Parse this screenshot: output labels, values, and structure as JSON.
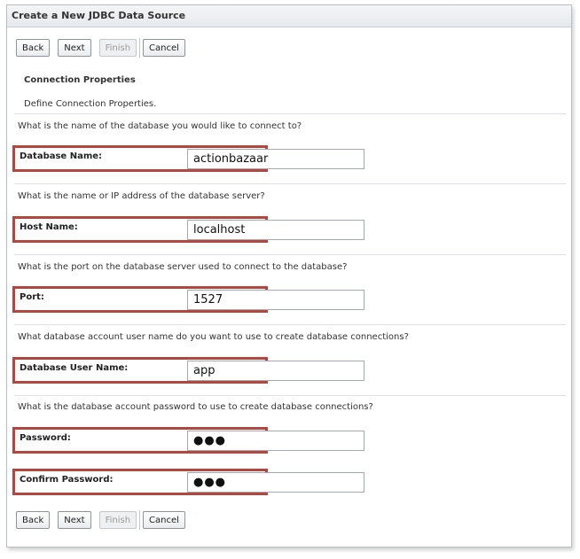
{
  "window": {
    "title": "Create a New JDBC Data Source"
  },
  "toolbar": {
    "back_label": "Back",
    "next_label": "Next",
    "finish_label": "Finish",
    "cancel_label": "Cancel"
  },
  "section": {
    "title": "Connection Properties",
    "description": "Define Connection Properties."
  },
  "questions": {
    "db_name": "What is the name of the database you would like to connect to?",
    "host": "What is the name or IP address of the database server?",
    "port": "What is the port on the database server used to connect to the database?",
    "user": "What database account user name do you want to use to create database connections?",
    "password": "What is the database account password to use to create database connections?"
  },
  "fields": {
    "database_name": {
      "label": "Database Name:",
      "value": "actionbazaar"
    },
    "host_name": {
      "label": "Host Name:",
      "value": "localhost"
    },
    "port": {
      "label": "Port:",
      "value": "1527"
    },
    "database_user_name": {
      "label": "Database User Name:",
      "value": "app"
    },
    "password": {
      "label": "Password:",
      "value": "●●●"
    },
    "confirm_password": {
      "label": "Confirm Password:",
      "value": "●●●"
    }
  }
}
